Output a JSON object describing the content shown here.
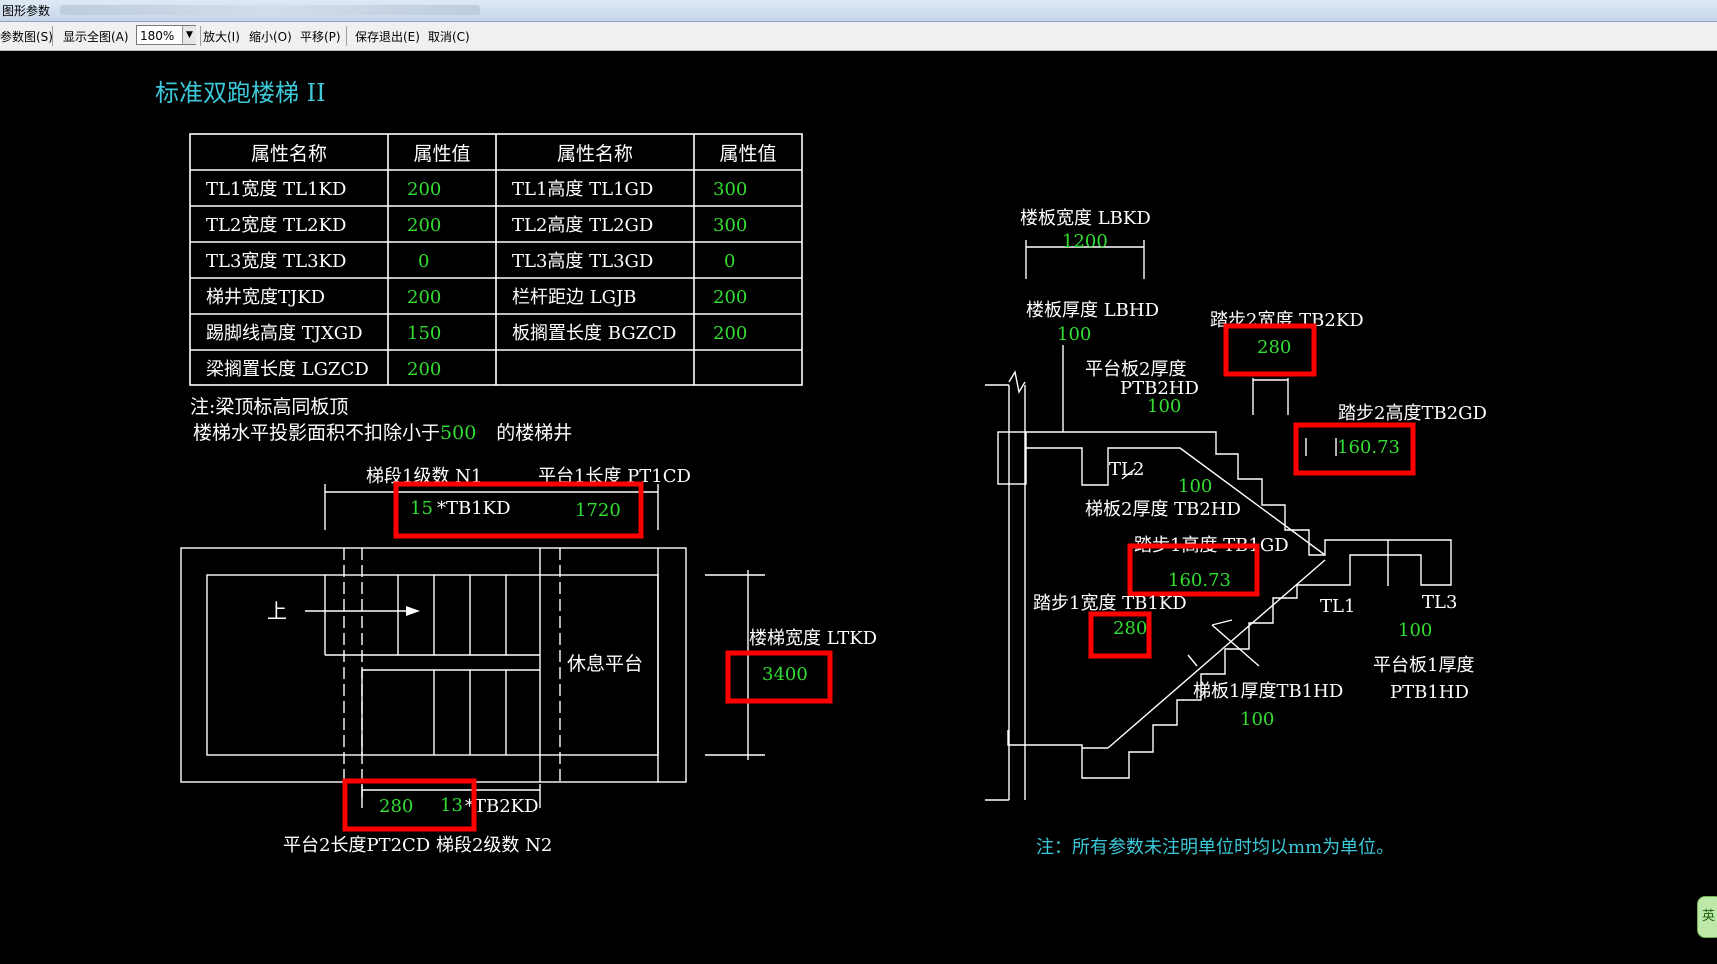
{
  "window": {
    "title": "图形参数"
  },
  "toolbar": {
    "items": [
      "参数图(S)",
      "显示全图(A)",
      "放大(I)",
      "缩小(O)",
      "平移(P)",
      "保存退出(E)",
      "取消(C)"
    ],
    "zoom_value": "180%"
  },
  "drawing": {
    "title": "标准双跑楼梯 II",
    "table": {
      "headers": [
        "属性名称",
        "属性值",
        "属性名称",
        "属性值"
      ],
      "rows": [
        [
          "TL1宽度 TL1KD",
          "200",
          "TL1高度 TL1GD",
          "300"
        ],
        [
          "TL2宽度 TL2KD",
          "200",
          "TL2高度 TL2GD",
          "300"
        ],
        [
          "TL3宽度 TL3KD",
          "0",
          "TL3高度 TL3GD",
          "0"
        ],
        [
          "梯井宽度TJKD",
          "200",
          "栏杆距边 LGJB",
          "200"
        ],
        [
          "踢脚线高度 TJXGD",
          "150",
          "板搁置长度 BGZCD",
          "200"
        ],
        [
          "梁搁置长度 LGZCD",
          "200",
          "",
          ""
        ]
      ]
    },
    "note1": "注:梁顶标高同板顶",
    "note2_prefix": "楼梯水平投影面积不扣除小于",
    "note2_value": "500",
    "note2_suffix": "的楼梯井",
    "plan": {
      "n1_label": "梯段1级数 N1",
      "pt1_label": "平台1长度 PT1CD",
      "n1_value": "15",
      "tb1_text": "*TB1KD",
      "pt1_value": "1720",
      "up_label": "上",
      "rest_label": "休息平台",
      "width_label": "楼梯宽度 LTKD",
      "width_value": "3400",
      "tb2_value": "280",
      "n2_value": "13",
      "tb2_text": "*TB2KD",
      "bottom_label": "平台2长度PT2CD  梯段2级数 N2"
    },
    "section": {
      "lbkd_label": "楼板宽度 LBKD",
      "lbkd_value": "1200",
      "lbhd_label": "楼板厚度 LBHD",
      "lbhd_value": "100",
      "tb2kd_label": "踏步2宽度 TB2KD",
      "tb2kd_value": "280",
      "ptb2_label1": "平台板2厚度",
      "ptb2_label2": "PTB2HD",
      "ptb2_value": "100",
      "tb2gd_label": "踏步2高度TB2GD",
      "tb2gd_value": "160.73",
      "tl2_label": "TL2",
      "tb2hd_value": "100",
      "tb2hd_label": "梯板2厚度 TB2HD",
      "tb1gd_label": "踏步1高度 TB1GD",
      "tb1gd_value": "160.73",
      "tb1kd_label": "踏步1宽度 TB1KD",
      "tb1kd_value": "280",
      "tl1_label": "TL1",
      "tl3_label": "TL3",
      "ptb1_value": "100",
      "ptb1_label1": "平台板1厚度",
      "ptb1_label2": "PTB1HD",
      "tb1hd_label": "梯板1厚度TB1HD",
      "tb1hd_value": "100"
    },
    "footnote": "注：所有参数未注明单位时均以mm为单位。"
  },
  "ime": {
    "label": "英"
  },
  "colors": {
    "white": "#ffffff",
    "green": "#33dd33",
    "cyan": "#3cc8d8",
    "red": "#ff0000",
    "background": "#000000"
  }
}
